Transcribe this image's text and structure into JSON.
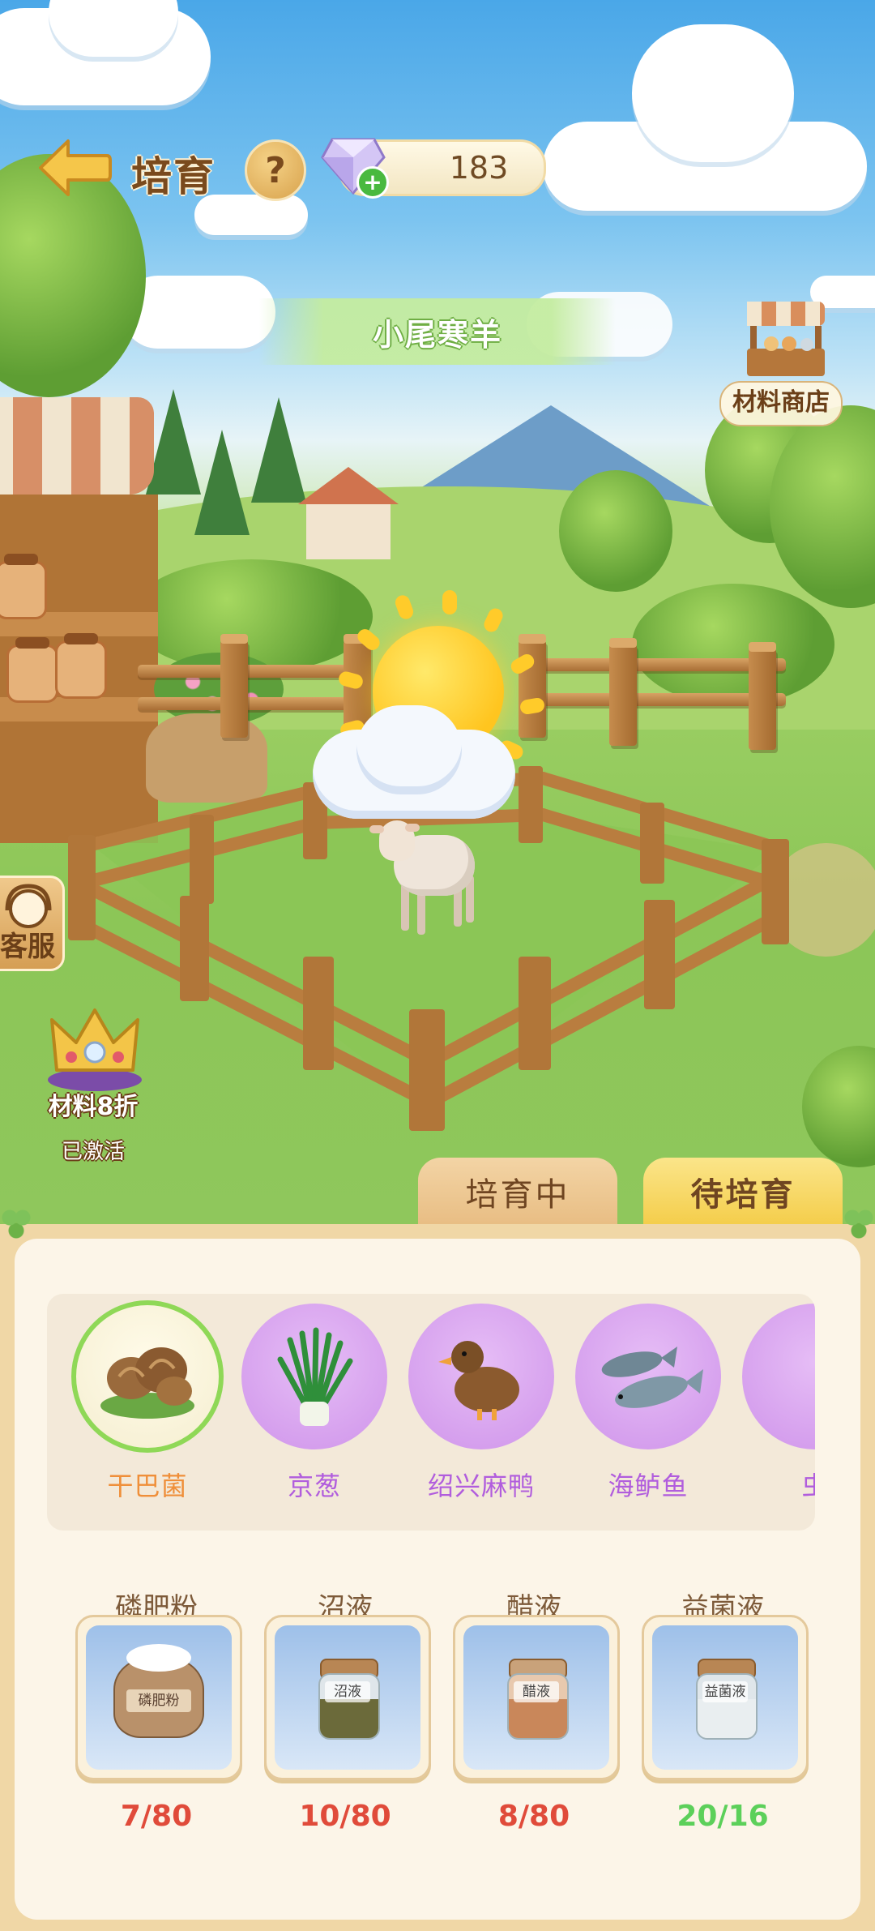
{
  "header": {
    "title": "培育",
    "help_symbol": "?",
    "gem_count": "183",
    "gem_plus": "+"
  },
  "pet": {
    "name": "小尾寒羊"
  },
  "shop": {
    "label": "材料商店"
  },
  "service": {
    "label": "客服"
  },
  "discount": {
    "label": "材料8折",
    "status": "已激活"
  },
  "tabs": [
    {
      "label": "培育中",
      "active": false
    },
    {
      "label": "待培育",
      "active": true
    }
  ],
  "items": [
    {
      "label": "干巴菌",
      "selected": true,
      "icon": "mushroom-icon"
    },
    {
      "label": "京葱",
      "selected": false,
      "icon": "scallion-icon"
    },
    {
      "label": "绍兴麻鸭",
      "selected": false,
      "icon": "duck-icon"
    },
    {
      "label": "海鲈鱼",
      "selected": false,
      "icon": "fish-icon"
    },
    {
      "label": "虫",
      "selected": false,
      "icon": "partial-item-icon"
    }
  ],
  "materials": [
    {
      "name": "磷肥粉",
      "tag": "磷肥粉",
      "count": "7/80",
      "enough": false,
      "icon": "fertilizer-sack-icon"
    },
    {
      "name": "沼液",
      "tag": "沼液",
      "count": "10/80",
      "enough": false,
      "icon": "biogas-jar-icon"
    },
    {
      "name": "醋液",
      "tag": "醋液",
      "count": "8/80",
      "enough": false,
      "icon": "vinegar-jar-icon"
    },
    {
      "name": "益菌液",
      "tag": "益菌液",
      "count": "20/16",
      "enough": true,
      "icon": "probiotic-jar-icon"
    }
  ],
  "colors": {
    "insufficient": "#e04b3a",
    "sufficient": "#5cd05a",
    "selected_ring": "#8fd857",
    "selected_label": "#ef8f3a",
    "item_label": "#b15ddd"
  },
  "weather": "sun-behind-cloud"
}
